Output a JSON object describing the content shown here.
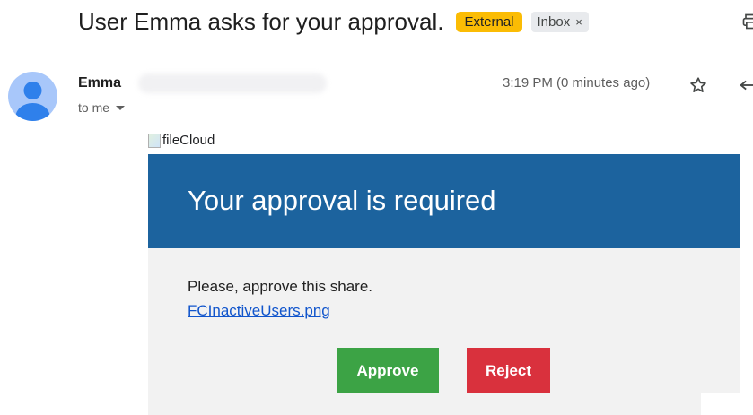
{
  "email": {
    "subject": "User Emma asks for your approval.",
    "labels": {
      "external": "External",
      "inbox": "Inbox",
      "inbox_remove": "×"
    },
    "sender": {
      "name": "Emma",
      "recipient_text": "to me"
    },
    "time": "3:19 PM (0 minutes ago)"
  },
  "body": {
    "logo_alt": "fileCloud",
    "banner_title": "Your approval is required",
    "message": "Please, approve this share.",
    "file_link": "FCInactiveUsers.png",
    "approve_label": "Approve",
    "reject_label": "Reject"
  },
  "colors": {
    "banner": "#1c639e",
    "approve": "#3ca345",
    "reject": "#d9313d",
    "external_label": "#fbbc04",
    "avatar": "#a8c7fa"
  },
  "icons": {
    "print": "print-icon",
    "star": "star-icon",
    "reply": "reply-icon",
    "avatar": "person-icon",
    "dropdown": "chevron-down-icon"
  }
}
